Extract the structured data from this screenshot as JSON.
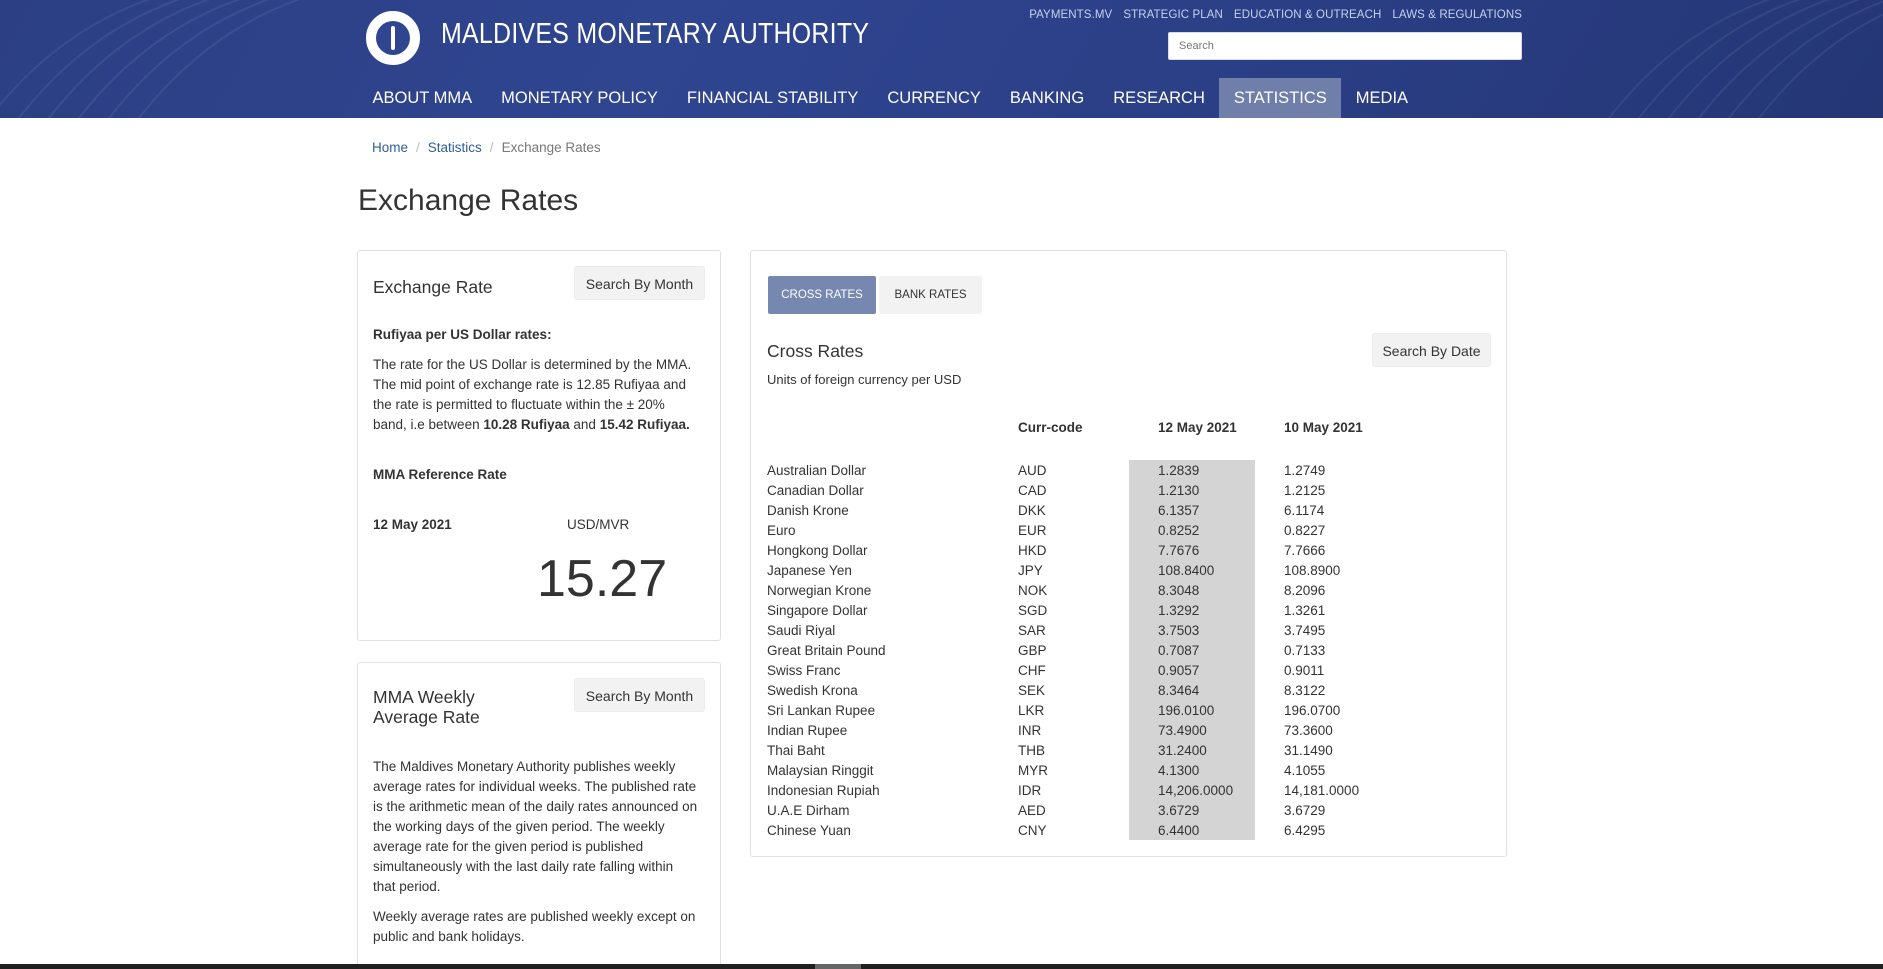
{
  "header": {
    "site_title": "MALDIVES MONETARY AUTHORITY",
    "top_links": [
      "PAYMENTS.MV",
      "STRATEGIC PLAN",
      "EDUCATION & OUTREACH",
      "LAWS & REGULATIONS"
    ],
    "search_placeholder": "Search",
    "nav": [
      "ABOUT MMA",
      "MONETARY POLICY",
      "FINANCIAL STABILITY",
      "CURRENCY",
      "BANKING",
      "RESEARCH",
      "STATISTICS",
      "MEDIA"
    ],
    "active_nav": "STATISTICS",
    "brand_color": "#2f4590"
  },
  "breadcrumb": {
    "home": "Home",
    "statistics": "Statistics",
    "current": "Exchange Rates"
  },
  "page_title": "Exchange Rates",
  "exchange_panel": {
    "title": "Exchange Rate",
    "search_button": "Search By Month",
    "subtitle": "Rufiyaa per US Dollar rates:",
    "body_line1": "The rate for the US Dollar is determined by the MMA.",
    "body_line2": "The mid point of exchange rate is 12.85 Rufiyaa and",
    "body_line3": "the rate is permitted to fluctuate within the ± 20%",
    "body_line4_prefix": "band, i.e between ",
    "body_low": "10.28 Rufiyaa",
    "body_and": " and ",
    "body_high": "15.42 Rufiyaa.",
    "reference_title": "MMA Reference Rate",
    "reference_date": "12 May 2021",
    "reference_pair": "USD/MVR",
    "reference_rate": "15.27"
  },
  "weekly_panel": {
    "title_line1": "MMA Weekly",
    "title_line2": "Average Rate",
    "search_button": "Search By Month",
    "para1": [
      "The Maldives Monetary Authority publishes weekly",
      "average rates for individual weeks. The published rate",
      "is the arithmetic mean of the daily rates announced on",
      "the working days of the given period. The weekly",
      "average rate for the given period is published",
      "simultaneously with the last daily rate falling within",
      "that period."
    ],
    "para2": [
      "Weekly average rates are published weekly except on",
      "public and bank holidays."
    ]
  },
  "cross_panel": {
    "tabs": [
      "CROSS RATES",
      "BANK RATES"
    ],
    "active_tab": "CROSS RATES",
    "title": "Cross Rates",
    "search_button": "Search By Date",
    "subtitle": "Units of foreign currency per USD",
    "columns": [
      "",
      "Curr-code",
      "12 May 2021",
      "10 May 2021"
    ],
    "rows": [
      [
        "Australian Dollar",
        "AUD",
        "1.2839",
        "1.2749"
      ],
      [
        "Canadian Dollar",
        "CAD",
        "1.2130",
        "1.2125"
      ],
      [
        "Danish Krone",
        "DKK",
        "6.1357",
        "6.1174"
      ],
      [
        "Euro",
        "EUR",
        "0.8252",
        "0.8227"
      ],
      [
        "Hongkong Dollar",
        "HKD",
        "7.7676",
        "7.7666"
      ],
      [
        "Japanese Yen",
        "JPY",
        "108.8400",
        "108.8900"
      ],
      [
        "Norwegian Krone",
        "NOK",
        "8.3048",
        "8.2096"
      ],
      [
        "Singapore Dollar",
        "SGD",
        "1.3292",
        "1.3261"
      ],
      [
        "Saudi Riyal",
        "SAR",
        "3.7503",
        "3.7495"
      ],
      [
        "Great Britain Pound",
        "GBP",
        "0.7087",
        "0.7133"
      ],
      [
        "Swiss Franc",
        "CHF",
        "0.9057",
        "0.9011"
      ],
      [
        "Swedish Krona",
        "SEK",
        "8.3464",
        "8.3122"
      ],
      [
        "Sri Lankan Rupee",
        "LKR",
        "196.0100",
        "196.0700"
      ],
      [
        "Indian Rupee",
        "INR",
        "73.4900",
        "73.3600"
      ],
      [
        "Thai Baht",
        "THB",
        "31.2400",
        "31.1490"
      ],
      [
        "Malaysian Ringgit",
        "MYR",
        "4.1300",
        "4.1055"
      ],
      [
        "Indonesian Rupiah",
        "IDR",
        "14,206.0000",
        "14,181.0000"
      ],
      [
        "U.A.E Dirham",
        "AED",
        "3.6729",
        "3.6729"
      ],
      [
        "Chinese Yuan",
        "CNY",
        "6.4400",
        "6.4295"
      ]
    ]
  }
}
